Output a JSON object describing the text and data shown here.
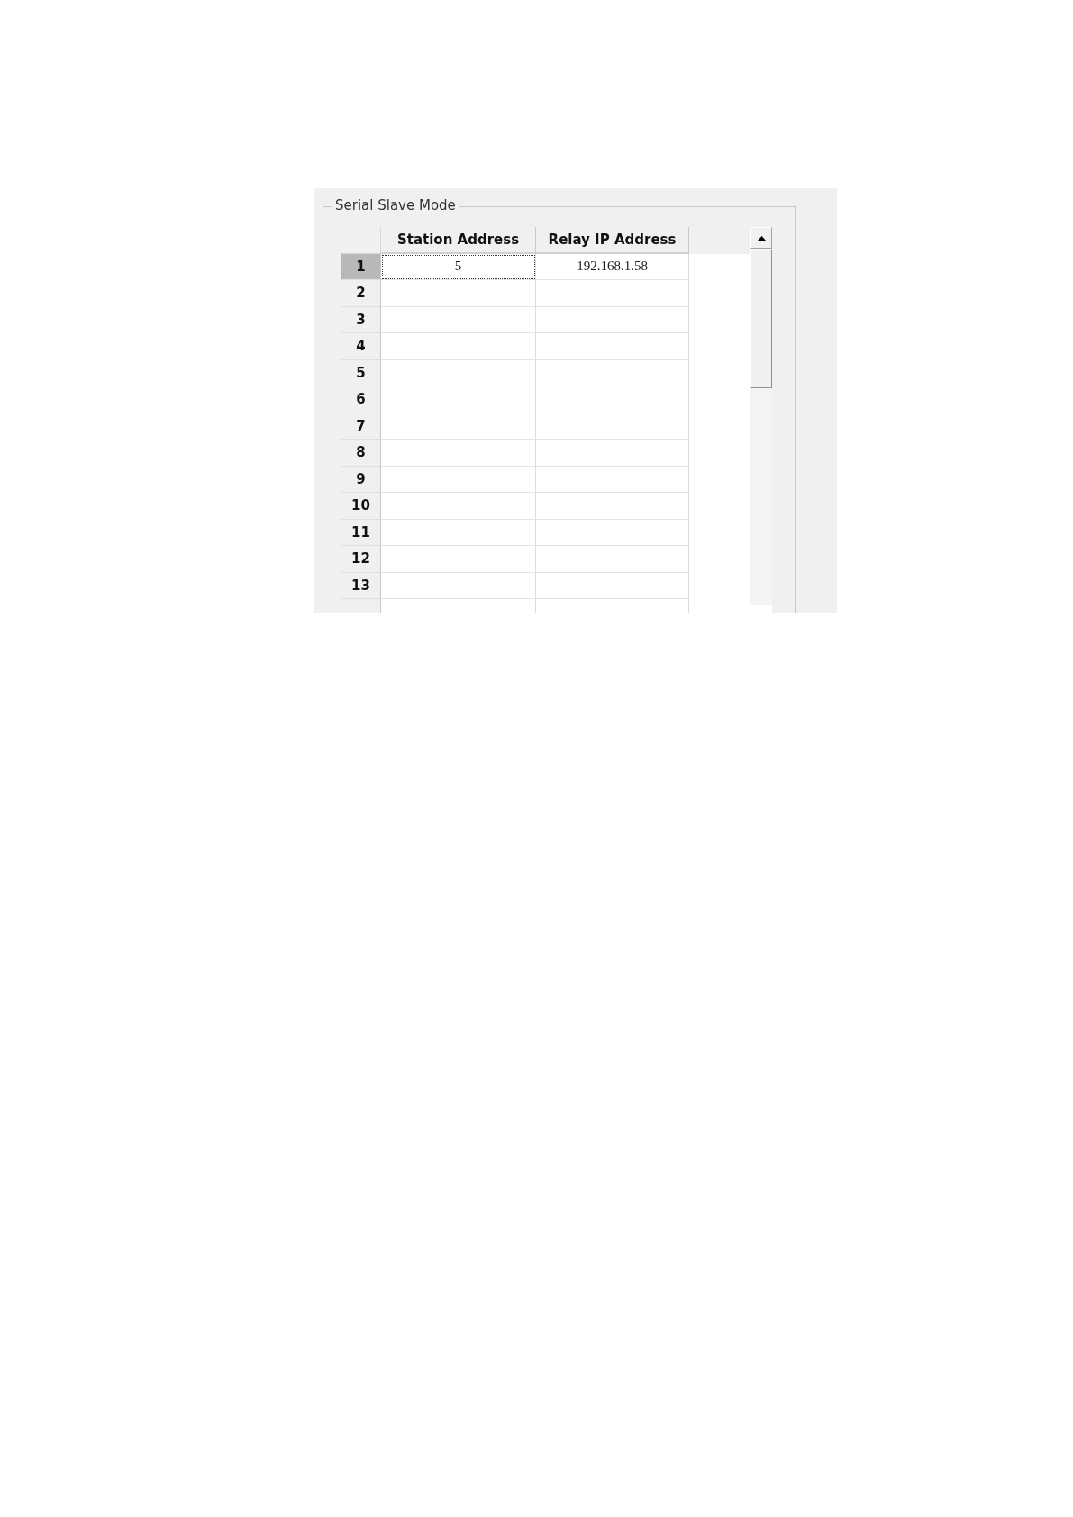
{
  "group": {
    "title": "Serial Slave Mode"
  },
  "table": {
    "columns": [
      "Station Address",
      "Relay IP Address"
    ],
    "rows": [
      {
        "label": "1",
        "selected": true,
        "cells": [
          "5",
          "192.168.1.58"
        ]
      },
      {
        "label": "2",
        "selected": false
      },
      {
        "label": "3",
        "selected": false
      },
      {
        "label": "4",
        "selected": false
      },
      {
        "label": "5",
        "selected": false
      },
      {
        "label": "6",
        "selected": false
      },
      {
        "label": "7",
        "selected": false
      },
      {
        "label": "8",
        "selected": false
      },
      {
        "label": "9",
        "selected": false
      },
      {
        "label": "10",
        "selected": false
      },
      {
        "label": "11",
        "selected": false
      },
      {
        "label": "12",
        "selected": false
      },
      {
        "label": "13",
        "selected": false
      }
    ]
  }
}
